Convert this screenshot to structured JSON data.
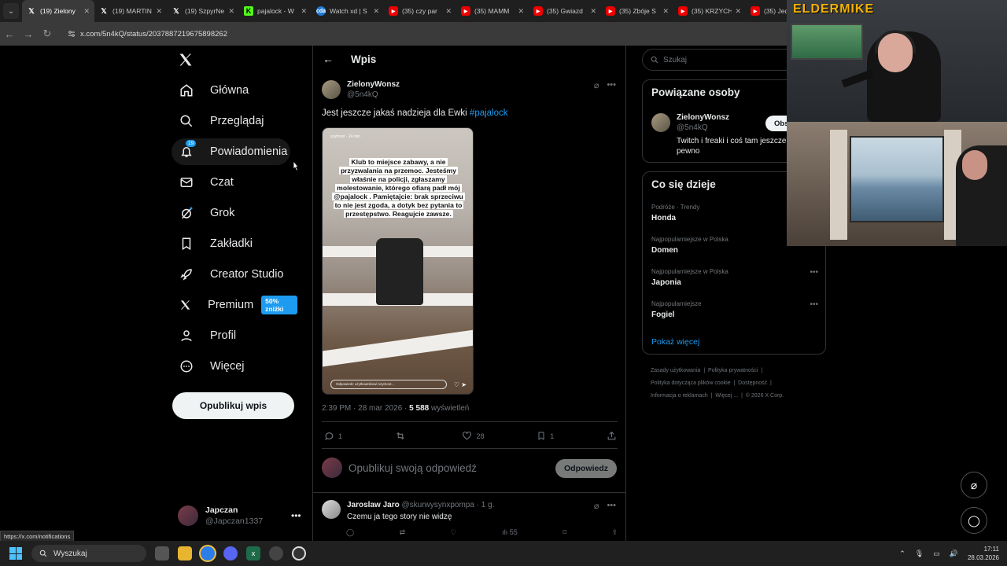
{
  "browser": {
    "tabs": [
      {
        "title": "(19) Zielony",
        "fav": "𝕏",
        "kind": "xl",
        "active": true
      },
      {
        "title": "(19) MARTIN",
        "fav": "𝕏",
        "kind": "xl"
      },
      {
        "title": "(19) SzpyrNe",
        "fav": "𝕏",
        "kind": "xl"
      },
      {
        "title": "pajalock - W",
        "fav": "K",
        "kind": "kick"
      },
      {
        "title": "Watch xd | S",
        "fav": "cda",
        "kind": "cda"
      },
      {
        "title": "(35) czy par",
        "fav": "▶",
        "kind": "yt"
      },
      {
        "title": "(35) MAMM",
        "fav": "▶",
        "kind": "yt"
      },
      {
        "title": "(35) Gwiazd",
        "fav": "▶",
        "kind": "yt"
      },
      {
        "title": "(35) Zbóje S",
        "fav": "▶",
        "kind": "yt"
      },
      {
        "title": "(35) KRZYCH",
        "fav": "▶",
        "kind": "yt"
      },
      {
        "title": "(35) Jed",
        "fav": "▶",
        "kind": "yt"
      }
    ],
    "url": "x.com/5n4kQ/status/2037887219675898262",
    "status_url": "https://x.com/notifications"
  },
  "sidebar": {
    "items": [
      {
        "label": "Główna",
        "icon": "home-icon"
      },
      {
        "label": "Przeglądaj",
        "icon": "search-icon"
      },
      {
        "label": "Powiadomienia",
        "icon": "bell-icon",
        "badge": "19"
      },
      {
        "label": "Czat",
        "icon": "mail-icon"
      },
      {
        "label": "Grok",
        "icon": "grok-icon"
      },
      {
        "label": "Zakładki",
        "icon": "bookmark-icon"
      },
      {
        "label": "Creator Studio",
        "icon": "rocket-icon"
      },
      {
        "label": "Premium",
        "icon": "x-logo-icon",
        "tag": "50% zniżki"
      },
      {
        "label": "Profil",
        "icon": "person-icon"
      },
      {
        "label": "Więcej",
        "icon": "more-circle-icon"
      }
    ],
    "post_button": "Opublikuj wpis",
    "me": {
      "name": "Japczan",
      "handle": "@Japczan1337"
    }
  },
  "main": {
    "title": "Wpis",
    "author": {
      "name": "ZielonyWonsz",
      "handle": "@5n4kQ"
    },
    "text": "Jest jeszcze jakaś nadzieja dla Ewki ",
    "hashtag": "#pajalock",
    "story": {
      "user": "szymoot  · 24 min",
      "text": "Klub to miejsce zabawy, a nie przyzwalania na przemoc. Jesteśmy właśnie na policji, zgłaszamy molestowanie, którego ofiarą padł mój @pajalock . Pamiętajcie: brak sprzeciwu to nie jest zgoda, a dotyk bez pytania to przestępstwo. Reagujcie zawsze.",
      "reply_placeholder": "Odpowiedz użytkownikowi szymoot..."
    },
    "time": "2:39 PM · 28 mar 2026 · ",
    "views": "5 588",
    "views_label": " wyświetleń",
    "actions": {
      "replies": "1",
      "retweets": "",
      "likes": "28",
      "bookmarks": "1"
    },
    "reply_placeholder": "Opublikuj swoją odpowiedź",
    "reply_button": "Odpowiedz",
    "reply": {
      "name": "Jaroslaw Jaro",
      "handle": "@skurwysynxpompa · 1 g.",
      "text": "Czemu ja tego story nie widzę",
      "views": "55"
    }
  },
  "right": {
    "search_placeholder": "Szukaj",
    "related_title": "Powiązane osoby",
    "related": {
      "name": "ZielonyWonsz",
      "handle": "@5n4kQ",
      "bio": "Twitch i freaki i coś tam jeszcze pewno",
      "button": "Obs"
    },
    "trends_title": "Co się dzieje",
    "trends": [
      {
        "context": "Podróże · Trendy",
        "name": "Honda"
      },
      {
        "context": "Najpopularniejsze w Polska",
        "name": "Domen"
      },
      {
        "context": "Najpopularniejsze w Polska",
        "name": "Japonia"
      },
      {
        "context": "Najpopularniejsze",
        "name": "Fogiel"
      }
    ],
    "show_more": "Pokaż więcej",
    "footer": {
      "l1": "Zasady użytkowania",
      "l2": "Polityka prywatności",
      "l3": "Polityka dotycząca plików cookie",
      "l4": "Dostępność",
      "l5": "Informacja o reklamach",
      "l6": "Więcej ...",
      "l7": "© 2026 X Corp.",
      "sep": "|"
    }
  },
  "overlay": {
    "brand": "ELDERMIKE"
  },
  "taskbar": {
    "search": "Wyszukaj",
    "time": "17:11",
    "date": "28.03.2026"
  },
  "colors": {
    "accent": "#1d9bf0",
    "background": "#000000",
    "border": "#2f3336",
    "muted": "#71767b"
  }
}
